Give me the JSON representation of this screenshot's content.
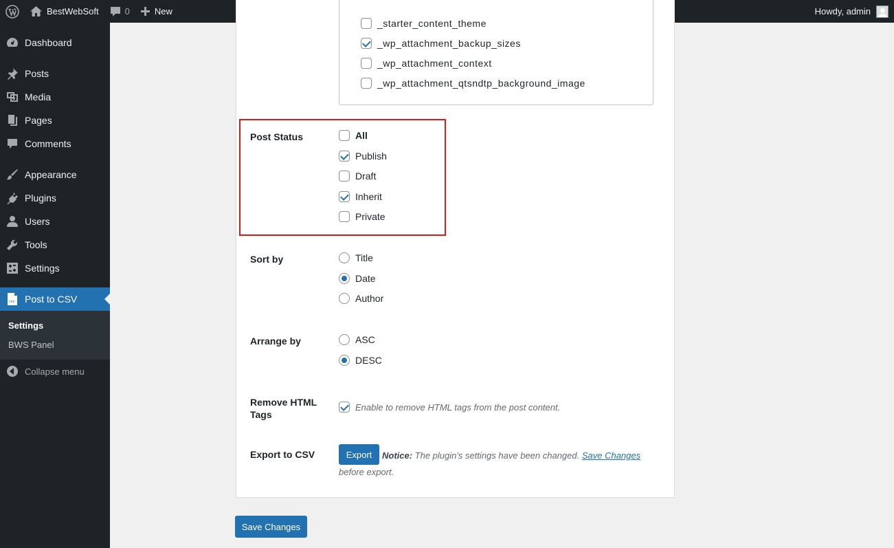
{
  "admin_bar": {
    "site_name": "BestWebSoft",
    "comments_count": "0",
    "new_label": "New",
    "greeting": "Howdy, admin"
  },
  "sidebar": {
    "items": [
      {
        "label": "Dashboard",
        "icon": "dashboard-icon"
      },
      {
        "label": "Posts",
        "icon": "pin-icon"
      },
      {
        "label": "Media",
        "icon": "media-icon"
      },
      {
        "label": "Pages",
        "icon": "pages-icon"
      },
      {
        "label": "Comments",
        "icon": "comment-icon"
      },
      {
        "label": "Appearance",
        "icon": "brush-icon"
      },
      {
        "label": "Plugins",
        "icon": "plugin-icon"
      },
      {
        "label": "Users",
        "icon": "user-icon"
      },
      {
        "label": "Tools",
        "icon": "wrench-icon"
      },
      {
        "label": "Settings",
        "icon": "settings-icon"
      },
      {
        "label": "Post to CSV",
        "icon": "csv-file-icon"
      }
    ],
    "submenu": [
      "Settings",
      "BWS Panel"
    ],
    "collapse_label": "Collapse menu"
  },
  "meta_keys": [
    {
      "label": "_starter_content_theme",
      "checked": false
    },
    {
      "label": "_wp_attachment_backup_sizes",
      "checked": true
    },
    {
      "label": "_wp_attachment_context",
      "checked": false
    },
    {
      "label": "_wp_attachment_qtsndtp_background_image",
      "checked": false
    }
  ],
  "post_status": {
    "label": "Post Status",
    "options": [
      {
        "label": "All",
        "checked": false
      },
      {
        "label": "Publish",
        "checked": true
      },
      {
        "label": "Draft",
        "checked": false
      },
      {
        "label": "Inherit",
        "checked": true
      },
      {
        "label": "Private",
        "checked": false
      }
    ]
  },
  "sort_by": {
    "label": "Sort by",
    "options": [
      {
        "label": "Title",
        "selected": false
      },
      {
        "label": "Date",
        "selected": true
      },
      {
        "label": "Author",
        "selected": false
      }
    ]
  },
  "arrange_by": {
    "label": "Arrange by",
    "options": [
      {
        "label": "ASC",
        "selected": false
      },
      {
        "label": "DESC",
        "selected": true
      }
    ]
  },
  "remove_html": {
    "label_line1": "Remove HTML",
    "label_line2": "Tags",
    "checked": true,
    "description": "Enable to remove HTML tags from the post content."
  },
  "export": {
    "label": "Export to CSV",
    "button": "Export",
    "notice_label": "Notice:",
    "notice_text": " The plugin's settings have been changed. ",
    "notice_link": "Save Changes",
    "notice_tail": " before export."
  },
  "save_button": "Save Changes",
  "colors": {
    "accent": "#2271b1",
    "admin_bar": "#1d2327",
    "highlight_border": "#e01818"
  }
}
